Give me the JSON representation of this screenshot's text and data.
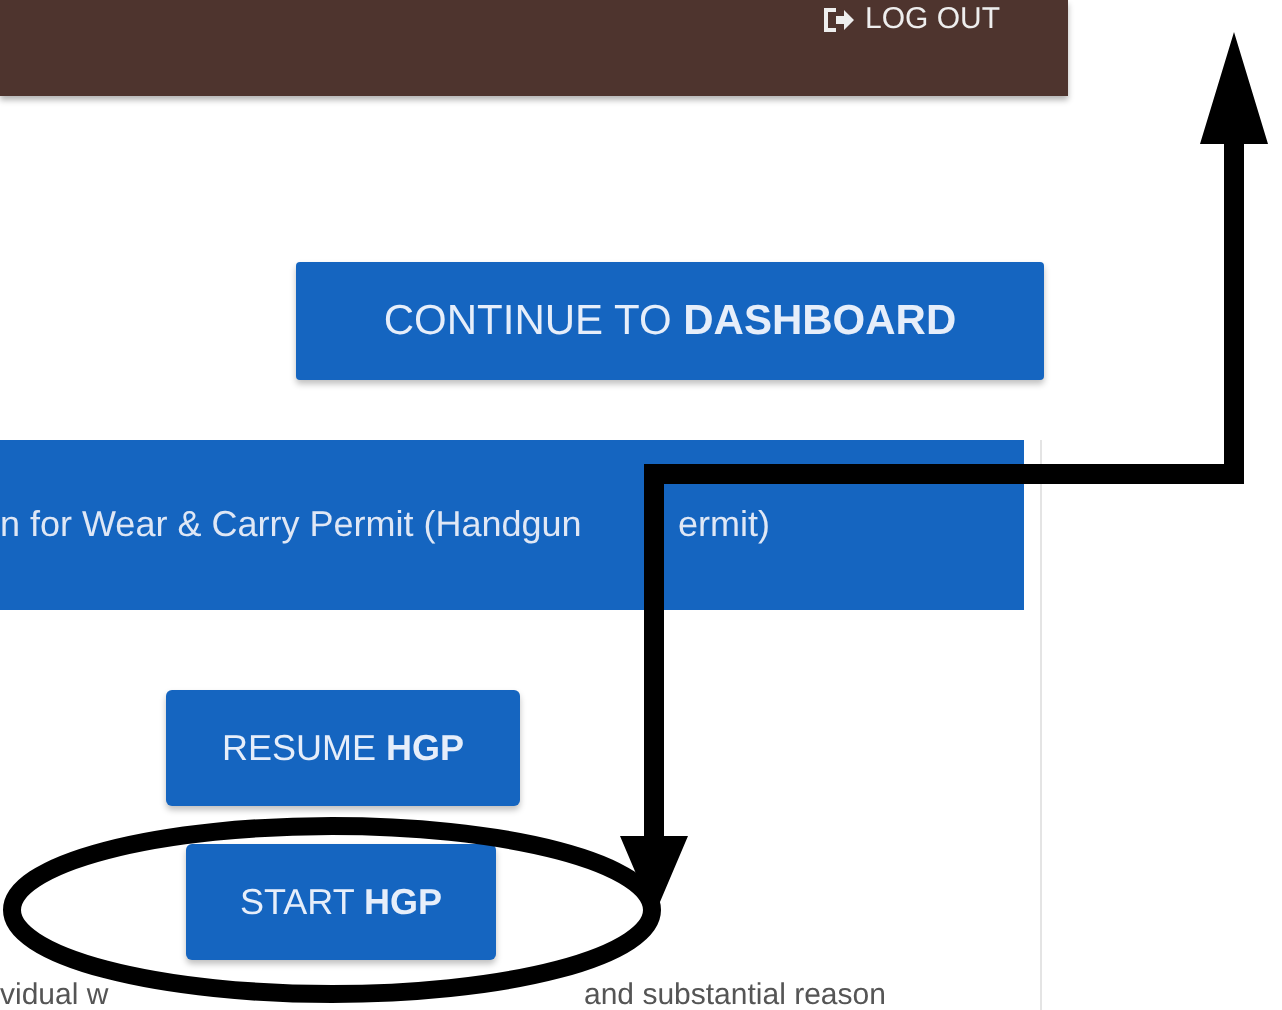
{
  "header": {
    "logout": "LOG OUT"
  },
  "continue_button": {
    "label": "CONTINUE TO",
    "emphasis": "DASHBOARD"
  },
  "card": {
    "title_parts": [
      "n for Wear & Carry Permit (Handgun",
      "ermit)"
    ],
    "buttons": [
      {
        "label": "RESUME",
        "emphasis": "HGP"
      },
      {
        "label": "START",
        "emphasis": "HGP"
      }
    ],
    "description_parts": [
      "vidual w",
      "and substantial reason"
    ]
  }
}
